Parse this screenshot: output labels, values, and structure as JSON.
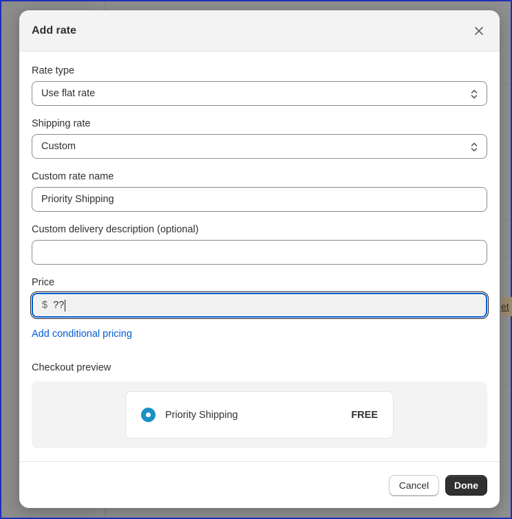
{
  "background": {
    "peek_text": "et"
  },
  "modal": {
    "title": "Add rate",
    "close_icon": "close-icon",
    "fields": {
      "rate_type": {
        "label": "Rate type",
        "value": "Use flat rate"
      },
      "shipping_rate": {
        "label": "Shipping rate",
        "value": "Custom"
      },
      "custom_rate_name": {
        "label": "Custom rate name",
        "value": "Priority Shipping"
      },
      "delivery_description": {
        "label": "Custom delivery description (optional)",
        "value": ""
      },
      "price": {
        "label": "Price",
        "prefix": "$",
        "value": "??"
      }
    },
    "conditional_link": "Add conditional pricing",
    "checkout_preview": {
      "label": "Checkout preview",
      "option_name": "Priority Shipping",
      "option_price": "FREE"
    },
    "footer": {
      "cancel_label": "Cancel",
      "done_label": "Done"
    }
  },
  "colors": {
    "accent_link": "#005bd3",
    "radio": "#1990c6",
    "primary_button": "#303030",
    "frame_border": "#1f2fb8"
  }
}
